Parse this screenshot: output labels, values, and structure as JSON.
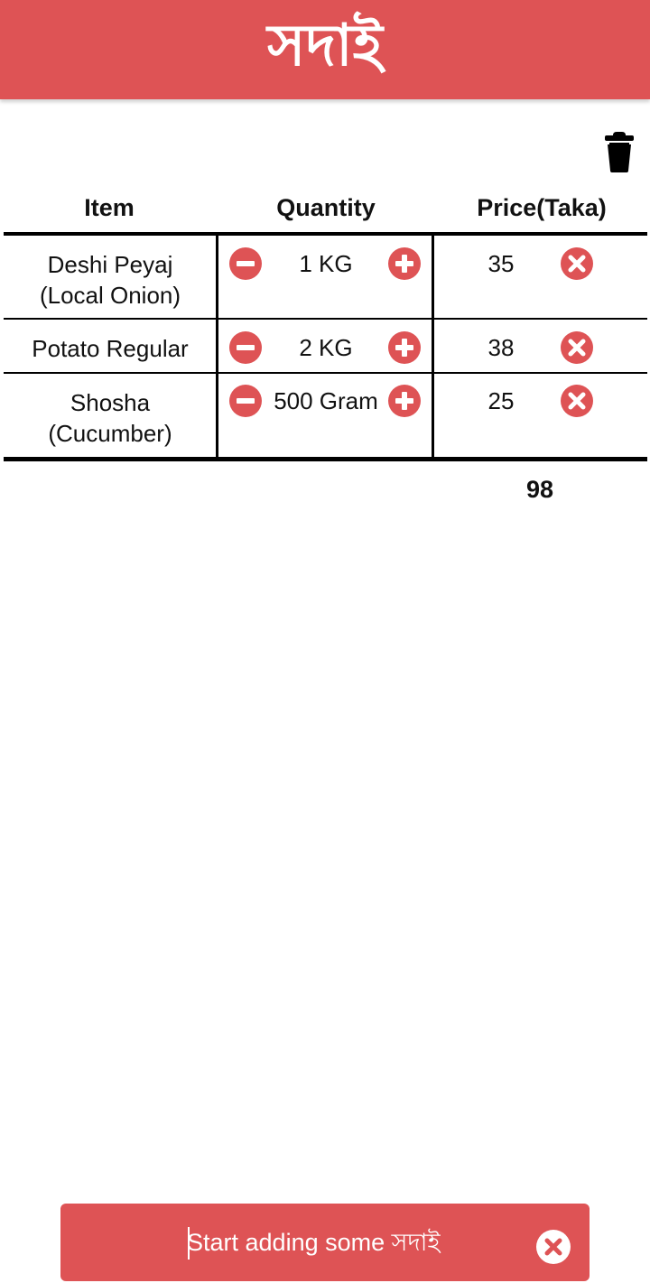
{
  "header": {
    "title": "সদাই"
  },
  "table": {
    "columns": [
      "Item",
      "Quantity",
      "Price(Taka)"
    ],
    "rows": [
      {
        "item_line1": "Deshi Peyaj",
        "item_line2": "(Local Onion)",
        "quantity": "1 KG",
        "price": "35"
      },
      {
        "item_line1": "Potato Regular",
        "item_line2": "",
        "quantity": "2 KG",
        "price": "38"
      },
      {
        "item_line1": "Shosha",
        "item_line2": "(Cucumber)",
        "quantity": "500 Gram",
        "price": "25"
      }
    ],
    "total": "98"
  },
  "input": {
    "placeholder": "Start adding some সদাই"
  },
  "icons": {
    "clear_all": "trash-icon",
    "decrease": "minus-circle-icon",
    "increase": "plus-circle-icon",
    "remove": "close-circle-icon",
    "clear_input": "close-circle-icon"
  },
  "colors": {
    "accent": "#de5355",
    "text": "#111111",
    "background": "#ffffff"
  }
}
